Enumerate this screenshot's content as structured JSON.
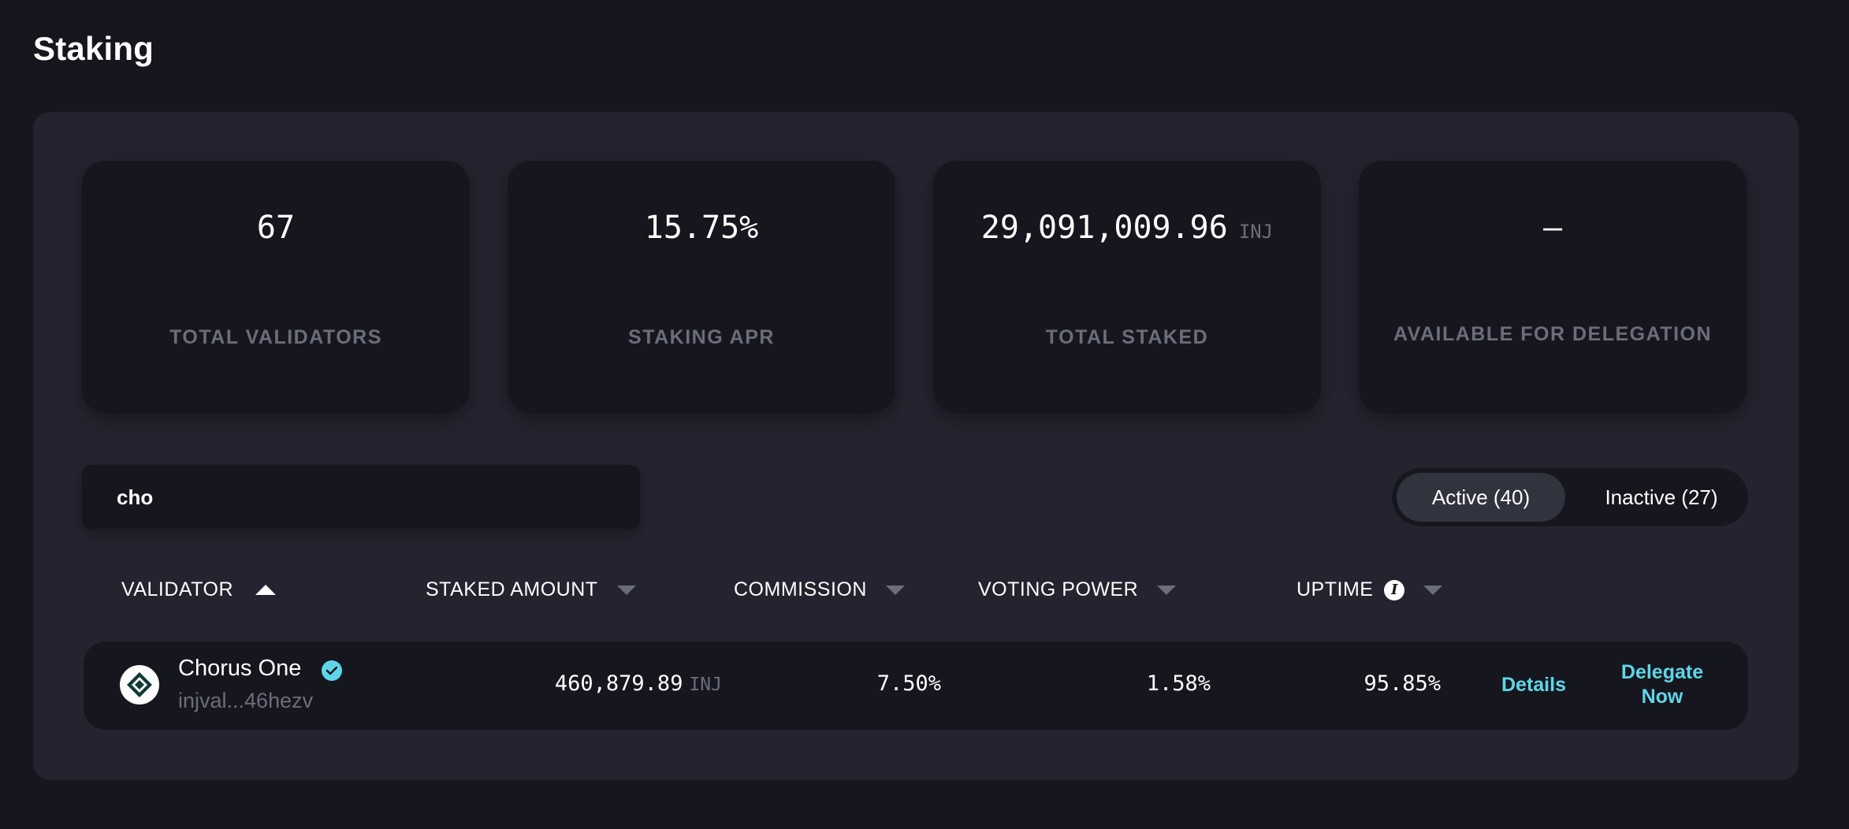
{
  "page": {
    "title": "Staking"
  },
  "stats": [
    {
      "value": "67",
      "unit": "",
      "label": "TOTAL VALIDATORS"
    },
    {
      "value": "15.75%",
      "unit": "",
      "label": "STAKING APR"
    },
    {
      "value": "29,091,009.96",
      "unit": "INJ",
      "label": "TOTAL STAKED"
    },
    {
      "value": "—",
      "unit": "",
      "label": "AVAILABLE FOR DELEGATION"
    }
  ],
  "search": {
    "value": "cho",
    "placeholder": ""
  },
  "tabs": {
    "active": "Active (40)",
    "inactive": "Inactive (27)"
  },
  "columns": {
    "validator": "VALIDATOR",
    "staked_amount": "STAKED AMOUNT",
    "commission": "COMMISSION",
    "voting_power": "VOTING POWER",
    "uptime": "UPTIME"
  },
  "rows": [
    {
      "name": "Chorus One",
      "address": "injval...46hezv",
      "staked_amount": "460,879.89",
      "unit": "INJ",
      "commission": "7.50%",
      "voting_power": "1.58%",
      "uptime": "95.85%",
      "details_label": "Details",
      "delegate_label": "Delegate Now"
    }
  ],
  "colors": {
    "accent": "#5fd6e8",
    "background": "#16171e",
    "panel": "#23242f",
    "muted": "#6b6d7c"
  },
  "icons": {
    "sort_asc": "caret-up-icon",
    "sort": "caret-down-icon",
    "info": "info-icon",
    "verified": "verified-check-icon",
    "validator_logo": "chorus-one-logo-icon"
  }
}
